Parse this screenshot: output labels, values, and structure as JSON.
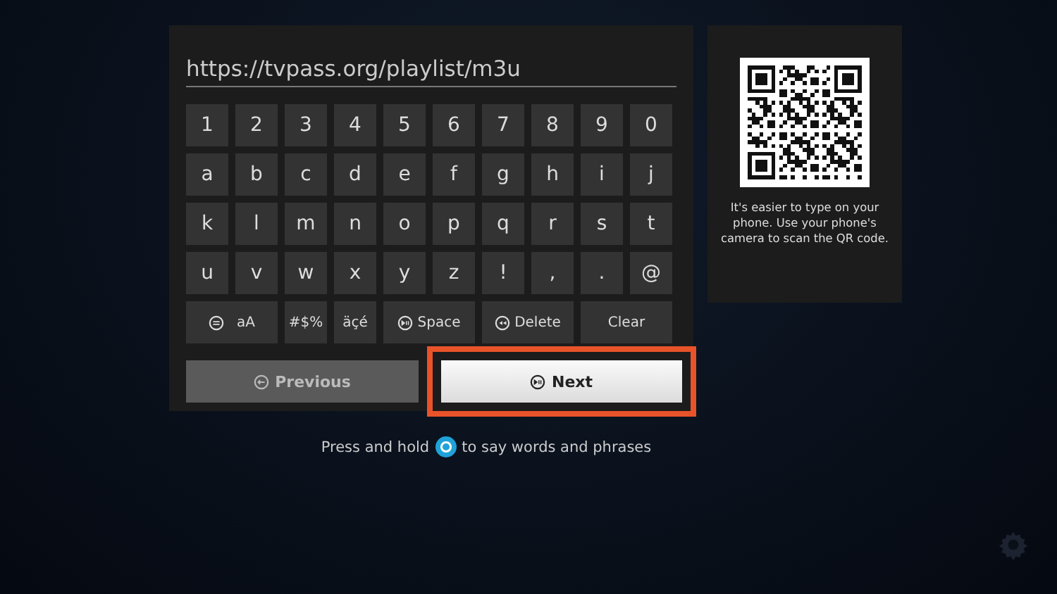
{
  "url_field": {
    "value": "https://tvpass.org/playlist/m3u"
  },
  "key_rows": [
    [
      "1",
      "2",
      "3",
      "4",
      "5",
      "6",
      "7",
      "8",
      "9",
      "0"
    ],
    [
      "a",
      "b",
      "c",
      "d",
      "e",
      "f",
      "g",
      "h",
      "i",
      "j"
    ],
    [
      "k",
      "l",
      "m",
      "n",
      "o",
      "p",
      "q",
      "r",
      "s",
      "t"
    ],
    [
      "u",
      "v",
      "w",
      "x",
      "y",
      "z",
      "!",
      ",",
      ".",
      "@"
    ]
  ],
  "special_keys": [
    {
      "kind": "case",
      "label": "aA"
    },
    {
      "kind": "symbols",
      "label": "#$%"
    },
    {
      "kind": "accents",
      "label": "äçé"
    },
    {
      "kind": "space",
      "label": "Space"
    },
    {
      "kind": "delete",
      "label": "Delete"
    },
    {
      "kind": "clear",
      "label": "Clear"
    }
  ],
  "nav_buttons": [
    {
      "kind": "previous",
      "label": "Previous",
      "selected": false,
      "highlighted": false
    },
    {
      "kind": "next",
      "label": "Next",
      "selected": true,
      "highlighted": true
    }
  ],
  "qr_panel": {
    "text": "It's easier to type on your phone. Use your phone's camera to scan the QR code."
  },
  "voice_hint": {
    "before": "Press and hold",
    "after": "to say words and phrases"
  }
}
